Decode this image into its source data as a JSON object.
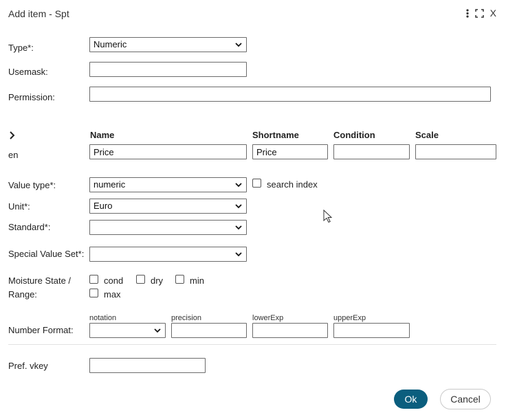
{
  "dialog": {
    "title": "Add item - Spt",
    "close_label": "X"
  },
  "fields": {
    "type_label": "Type*:",
    "type_value": "Numeric",
    "usemask_label": "Usemask:",
    "usemask_value": "",
    "permission_label": "Permission:",
    "permission_value": ""
  },
  "lang": {
    "headers": {
      "name": "Name",
      "shortname": "Shortname",
      "condition": "Condition",
      "scale": "Scale"
    },
    "row_lang": "en",
    "name_value": "Price",
    "shortname_value": "Price",
    "condition_value": "",
    "scale_value": ""
  },
  "value": {
    "value_type_label": "Value type*:",
    "value_type_value": "numeric",
    "search_index_label": "search index",
    "unit_label": "Unit*:",
    "unit_value": "Euro",
    "standard_label": "Standard*:",
    "standard_value": "",
    "special_label": "Special Value Set*:",
    "special_value": ""
  },
  "moisture": {
    "label_line1": "Moisture State /",
    "label_line2": "Range:",
    "options": [
      "cond",
      "dry",
      "min",
      "max"
    ]
  },
  "number_format": {
    "label": "Number Format:",
    "notation_label": "notation",
    "precision_label": "precision",
    "lowerexp_label": "lowerExp",
    "upperexp_label": "upperExp",
    "notation_value": "",
    "precision_value": "",
    "lowerexp_value": "",
    "upperexp_value": ""
  },
  "pref": {
    "label": "Pref. vkey",
    "value": ""
  },
  "buttons": {
    "ok": "Ok",
    "cancel": "Cancel"
  },
  "colors": {
    "primary": "#0b5e7e",
    "border": "#6b6b6b"
  }
}
